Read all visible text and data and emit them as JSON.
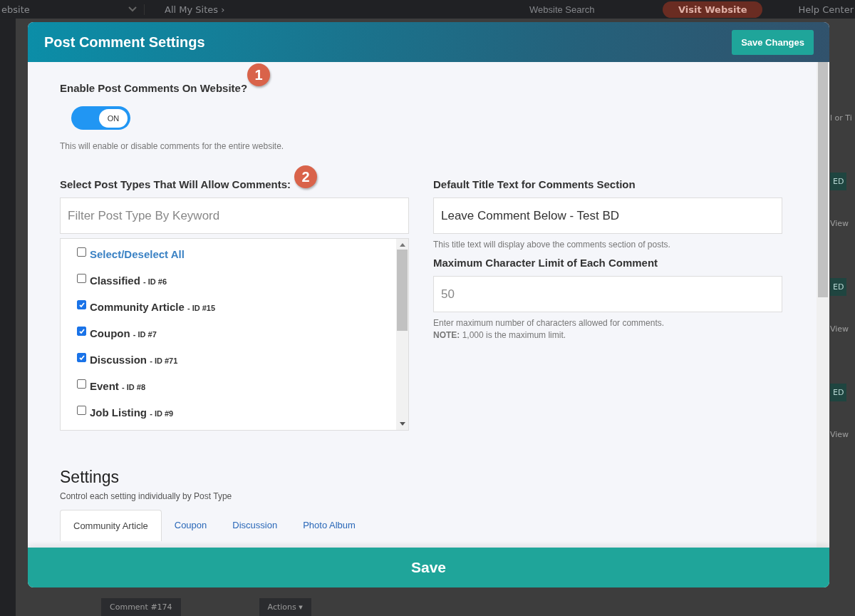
{
  "background": {
    "topbar": {
      "site_select": "ebsite",
      "breadcrumb": "All My Sites ›",
      "search": {
        "placeholder": "Website Search"
      },
      "visit_button": "Visit Website",
      "help": "Help Center"
    },
    "right_edge": [
      "l or Ti",
      "ED",
      "View",
      "ED",
      "View",
      "ED",
      "View"
    ],
    "bottom": {
      "comment_tag": "Comment #174",
      "actions": "Actions ▾"
    }
  },
  "modal": {
    "title": "Post Comment Settings",
    "save_changes": "Save Changes",
    "enable": {
      "label": "Enable Post Comments On Website?",
      "badge": "1",
      "on": true,
      "toggle_text": "ON",
      "help": "This will enable or disable comments for the entire website."
    },
    "post_types": {
      "label": "Select Post Types That Will Allow Comments:",
      "badge": "2",
      "filter": {
        "placeholder": "Filter Post Type By Keyword"
      },
      "items": [
        {
          "kind": "all",
          "name": "Select/Deselect All",
          "checked": false
        },
        {
          "kind": "type",
          "name": "Classified",
          "id": "- ID #6",
          "checked": false
        },
        {
          "kind": "type",
          "name": "Community Article",
          "id": "- ID #15",
          "checked": true
        },
        {
          "kind": "type",
          "name": "Coupon",
          "id": "- ID #7",
          "checked": true
        },
        {
          "kind": "type",
          "name": "Discussion",
          "id": "- ID #71",
          "checked": true
        },
        {
          "kind": "type",
          "name": "Event",
          "id": "- ID #8",
          "checked": false
        },
        {
          "kind": "type",
          "name": "Job Listing",
          "id": "- ID #9",
          "checked": false
        }
      ]
    },
    "title_text": {
      "label": "Default Title Text for Comments Section",
      "value": "Leave Comment Below - Test BD",
      "help": "This title text will display above the comments section of posts."
    },
    "char_limit": {
      "label": "Maximum Character Limit of Each Comment",
      "placeholder": "50",
      "help": "Enter maximum number of characters allowed for comments.",
      "note_label": "NOTE:",
      "note": "1,000 is the maximum limit."
    },
    "settings": {
      "title": "Settings",
      "subtitle": "Control each setting individually by Post Type",
      "tabs": [
        {
          "label": "Community Article",
          "selected": true
        },
        {
          "label": "Coupon",
          "selected": false
        },
        {
          "label": "Discussion",
          "selected": false
        },
        {
          "label": "Photo Album",
          "selected": false
        }
      ]
    },
    "save": "Save"
  }
}
